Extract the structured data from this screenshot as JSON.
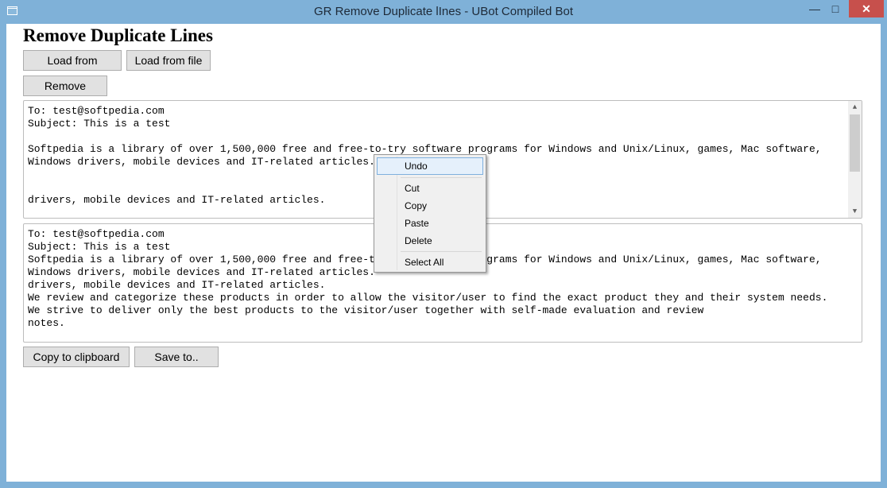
{
  "window": {
    "title": "GR Remove Duplicate lInes - UBot Compiled Bot",
    "app_icon": "window-app-icon",
    "controls": {
      "minimize": "—",
      "maximize": "□",
      "close": "✕"
    }
  },
  "heading": "Remove Duplicate Lines",
  "buttons": {
    "load_clipboard": "Load from clipboard",
    "load_file": "Load from file",
    "remove": "Remove",
    "copy_clipboard": "Copy to clipboard",
    "save_to": "Save to.."
  },
  "input_text": {
    "lines": [
      "To: test@softpedia.com",
      "Subject: This is a test",
      "",
      "Softpedia is a library of over 1,500,000 free and free-to-try software programs for Windows and Unix/Linux, games, Mac software,",
      "Windows drivers, mobile devices and IT-related articles.",
      "",
      "",
      "drivers, mobile devices and IT-related articles."
    ]
  },
  "output_text": {
    "lines": [
      "To: test@softpedia.com",
      "Subject: This is a test",
      "Softpedia is a library of over 1,500,000 free and free-to-try software programs for Windows and Unix/Linux, games, Mac software,",
      "Windows drivers, mobile devices and IT-related articles.",
      "drivers, mobile devices and IT-related articles.",
      "We review and categorize these products in order to allow the visitor/user to find the exact product they and their system needs.",
      "We strive to deliver only the best products to the visitor/user together with self-made evaluation and review",
      "notes."
    ]
  },
  "context_menu": {
    "items": [
      "Undo",
      "Cut",
      "Copy",
      "Paste",
      "Delete",
      "Select All"
    ],
    "highlighted": "Undo"
  },
  "scrollbar": {
    "up_arrow": "▲",
    "down_arrow": "▼"
  },
  "colors": {
    "titlebar": "#7fb1d8",
    "close_button": "#c7504c",
    "menu_highlight": "#e5f0fb"
  }
}
